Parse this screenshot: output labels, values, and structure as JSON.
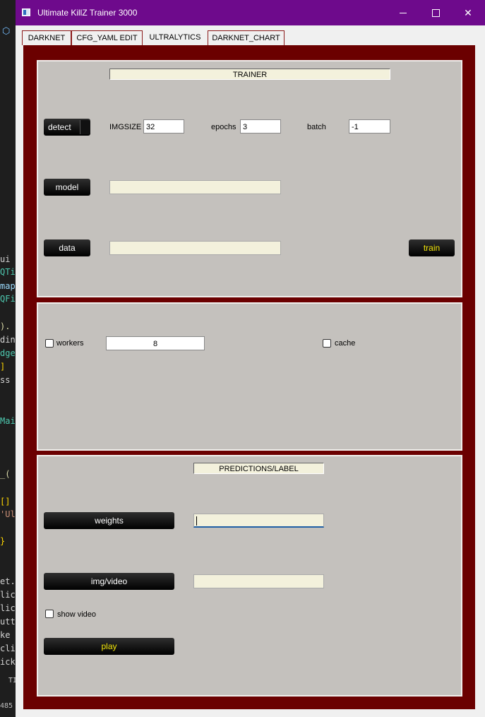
{
  "window": {
    "title": "Ultimate KillZ Trainer 3000",
    "minimize_glyph": "",
    "maximize_glyph": "",
    "close_glyph": "✕"
  },
  "tabs": [
    {
      "label": "DARKNET"
    },
    {
      "label": "CFG_YAML EDIT"
    },
    {
      "label": "ULTRALYTICS",
      "active": true
    },
    {
      "label": "DARKNET_CHART"
    }
  ],
  "trainer": {
    "header": "TRAINER",
    "task_button": "detect",
    "imgsize_label": "IMGSIZE",
    "imgsize_value": "32",
    "epochs_label": "epochs",
    "epochs_value": "3",
    "batch_label": "batch",
    "batch_value": "-1",
    "model_button": "model",
    "model_value": "",
    "data_button": "data",
    "data_value": "",
    "train_button": "train"
  },
  "options": {
    "workers_label": "workers",
    "workers_checked": false,
    "workers_value": "8",
    "cache_label": "cache",
    "cache_checked": false
  },
  "predictions": {
    "header": "PREDICTIONS/LABEL",
    "weights_button": "weights",
    "weights_value": "",
    "imgvideo_button": "img/video",
    "imgvideo_value": "",
    "show_video_label": "show video",
    "show_video_checked": false,
    "play_button": "play"
  },
  "background_editor": {
    "fragments": [
      "ui",
      "QTi",
      "map",
      "QFi",
      ").",
      "din",
      "dge",
      "]",
      "ss",
      "Mai",
      "_(",
      "[]",
      "'Ul",
      "}",
      "et.",
      "lic",
      "lic",
      "utt",
      "ke",
      "cli",
      "ick",
      "TI",
      "485"
    ]
  },
  "colors": {
    "titlebar": "#6e0a8c",
    "pane": "#6b0000",
    "group": "#c4c1bd",
    "accent_text": "#f3e60a"
  }
}
